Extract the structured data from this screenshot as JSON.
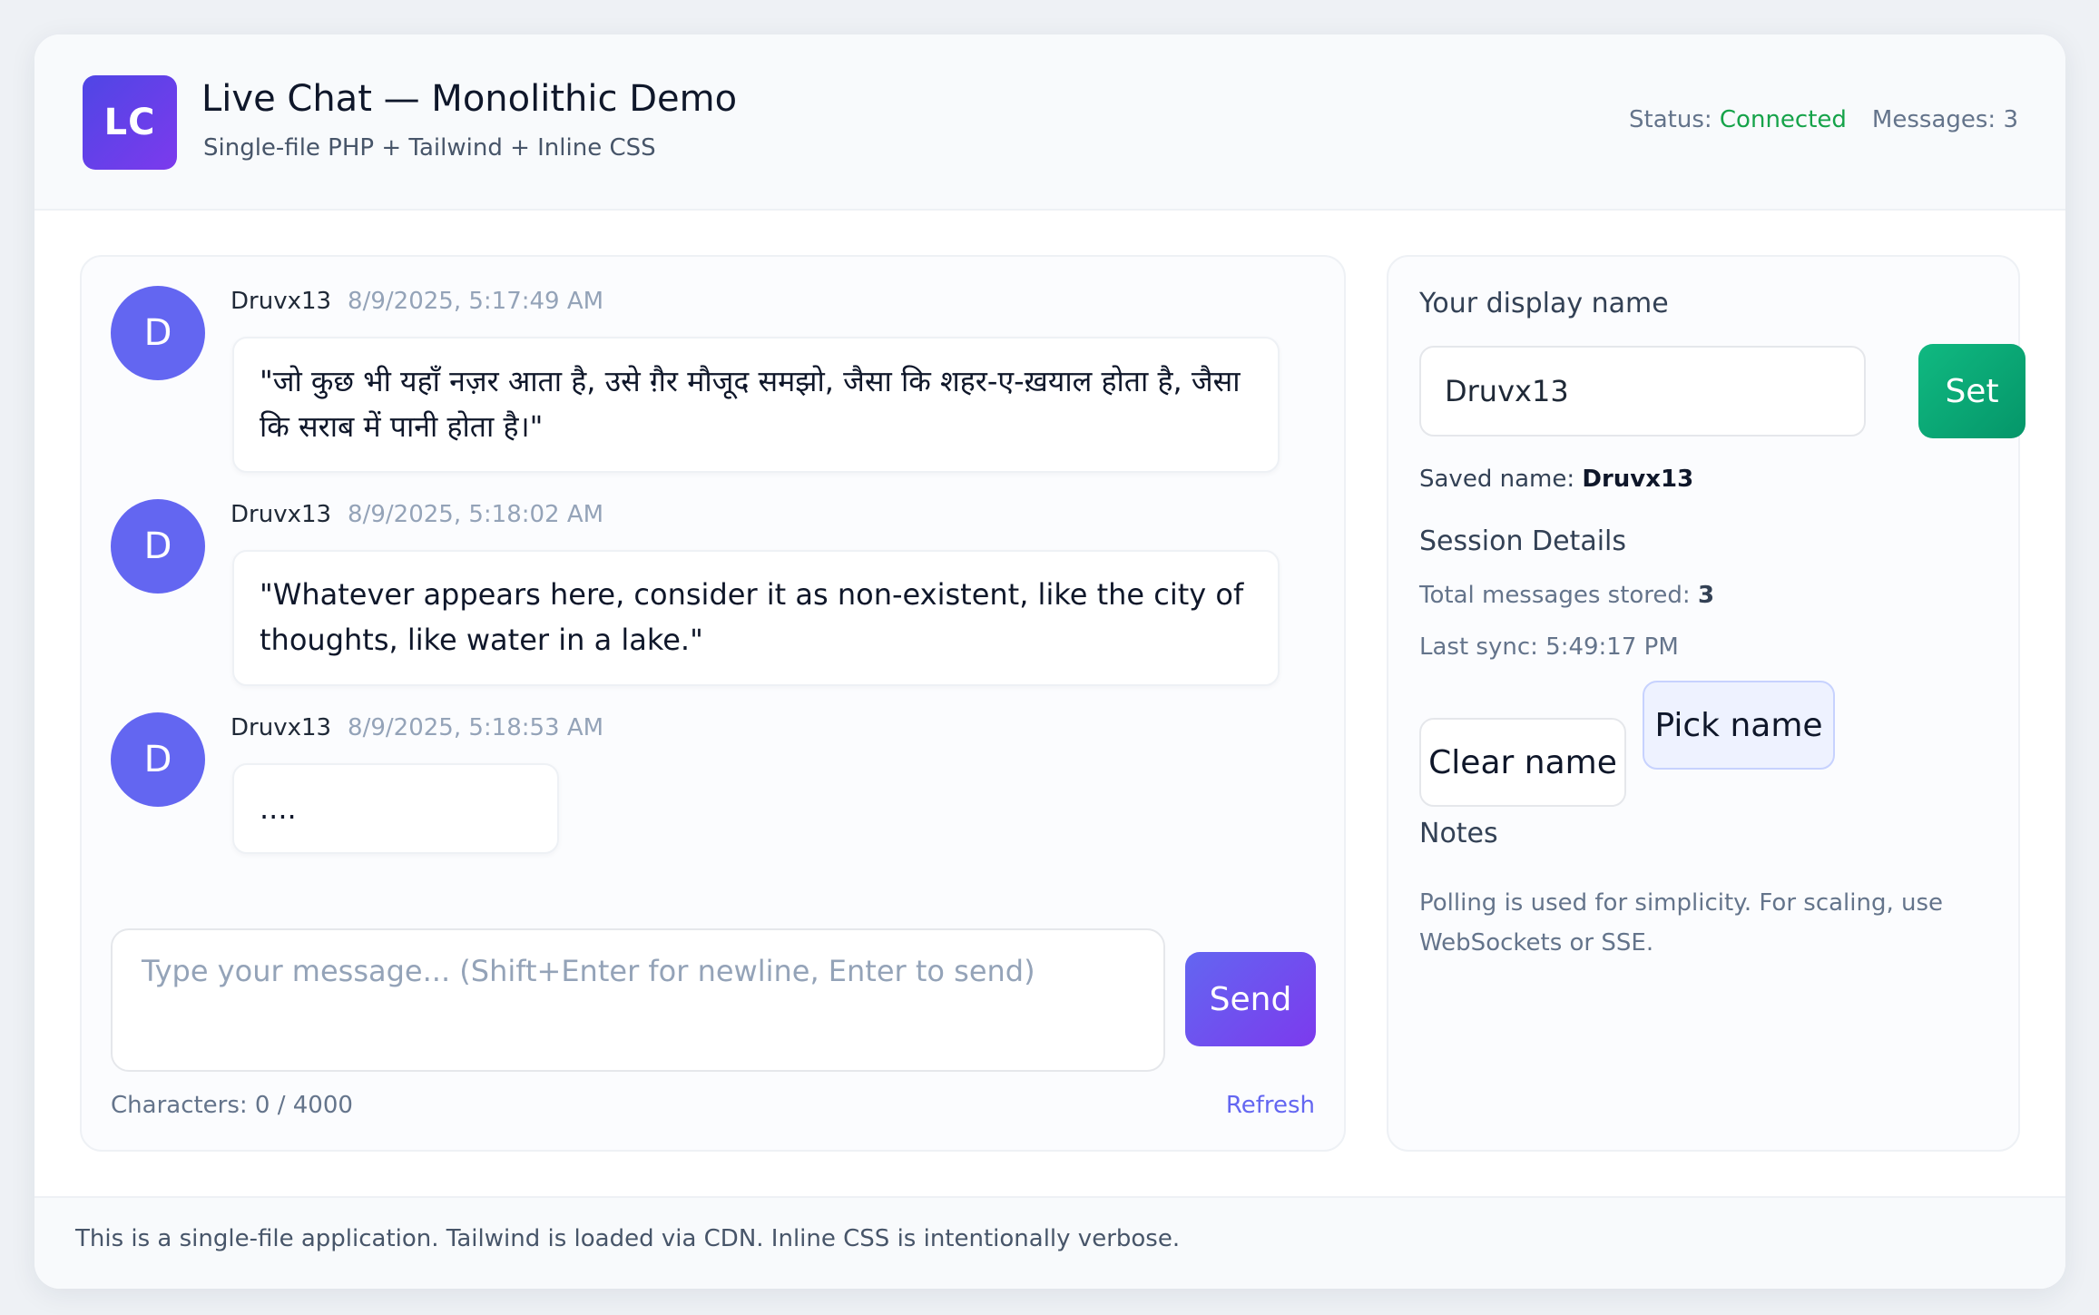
{
  "header": {
    "logo": "LC",
    "title": "Live Chat — Monolithic Demo",
    "subtitle": "Single-file PHP + Tailwind + Inline CSS",
    "status_label": "Status:",
    "status_value": "Connected",
    "messages_label": "Messages: 3"
  },
  "messages": [
    {
      "avatar": "D",
      "author": "Druvx13",
      "time": "8/9/2025, 5:17:49 AM",
      "text": "\"जो कुछ भी यहाँ नज़र आता है, उसे ग़ैर मौजूद समझो, जैसा कि शहर-ए-ख़याल होता है, जैसा कि सराब में पानी होता है।\""
    },
    {
      "avatar": "D",
      "author": "Druvx13",
      "time": "8/9/2025, 5:18:02 AM",
      "text": "\"Whatever appears here, consider it as non-existent, like the city of thoughts, like water in a lake.\""
    },
    {
      "avatar": "D",
      "author": "Druvx13",
      "time": "8/9/2025, 5:18:53 AM",
      "text": "...."
    }
  ],
  "composer": {
    "placeholder": "Type your message... (Shift+Enter for newline, Enter to send)",
    "send_label": "Send",
    "char_count": "Characters: 0 / 4000",
    "refresh_label": "Refresh"
  },
  "sidebar": {
    "display_name_label": "Your display name",
    "name_value": "Druvx13",
    "set_label": "Set",
    "saved_prefix": "Saved name:",
    "saved_name": "Druvx13",
    "session_heading": "Session Details",
    "total_prefix": "Total messages stored:",
    "total_value": "3",
    "last_sync": "Last sync: 5:49:17 PM",
    "clear_label": "Clear name",
    "pick_label": "Pick name",
    "notes_heading": "Notes",
    "notes_text": "Polling is used for simplicity. For scaling, use WebSockets or SSE."
  },
  "footer": {
    "text": "This is a single-file application. Tailwind is loaded via CDN. Inline CSS is intentionally verbose."
  },
  "colors": {
    "accent": "#6366f1",
    "connected": "#16a34a",
    "set_button": "#059669"
  }
}
